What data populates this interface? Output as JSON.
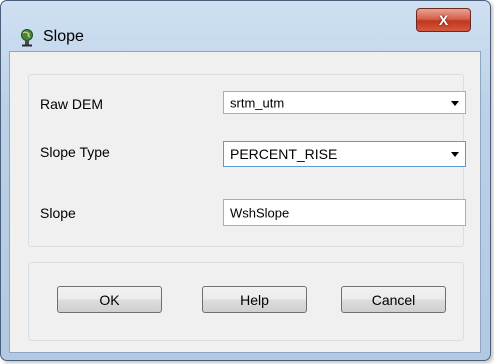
{
  "window": {
    "title": "Slope",
    "close_label": "X"
  },
  "form": {
    "raw_dem": {
      "label": "Raw DEM",
      "value": "srtm_utm"
    },
    "slope_type": {
      "label": "Slope Type",
      "value": "PERCENT_RISE"
    },
    "slope": {
      "label": "Slope",
      "value": "WshSlope"
    }
  },
  "buttons": {
    "ok": "OK",
    "help": "Help",
    "cancel": "Cancel"
  },
  "colors": {
    "close_button": "#c1361e",
    "titlebar": "#bcd1e8",
    "client_bg": "#f0f0f0"
  },
  "icons": {
    "app": "globe-person-icon",
    "close": "close-icon",
    "dropdown": "chevron-down-icon"
  }
}
